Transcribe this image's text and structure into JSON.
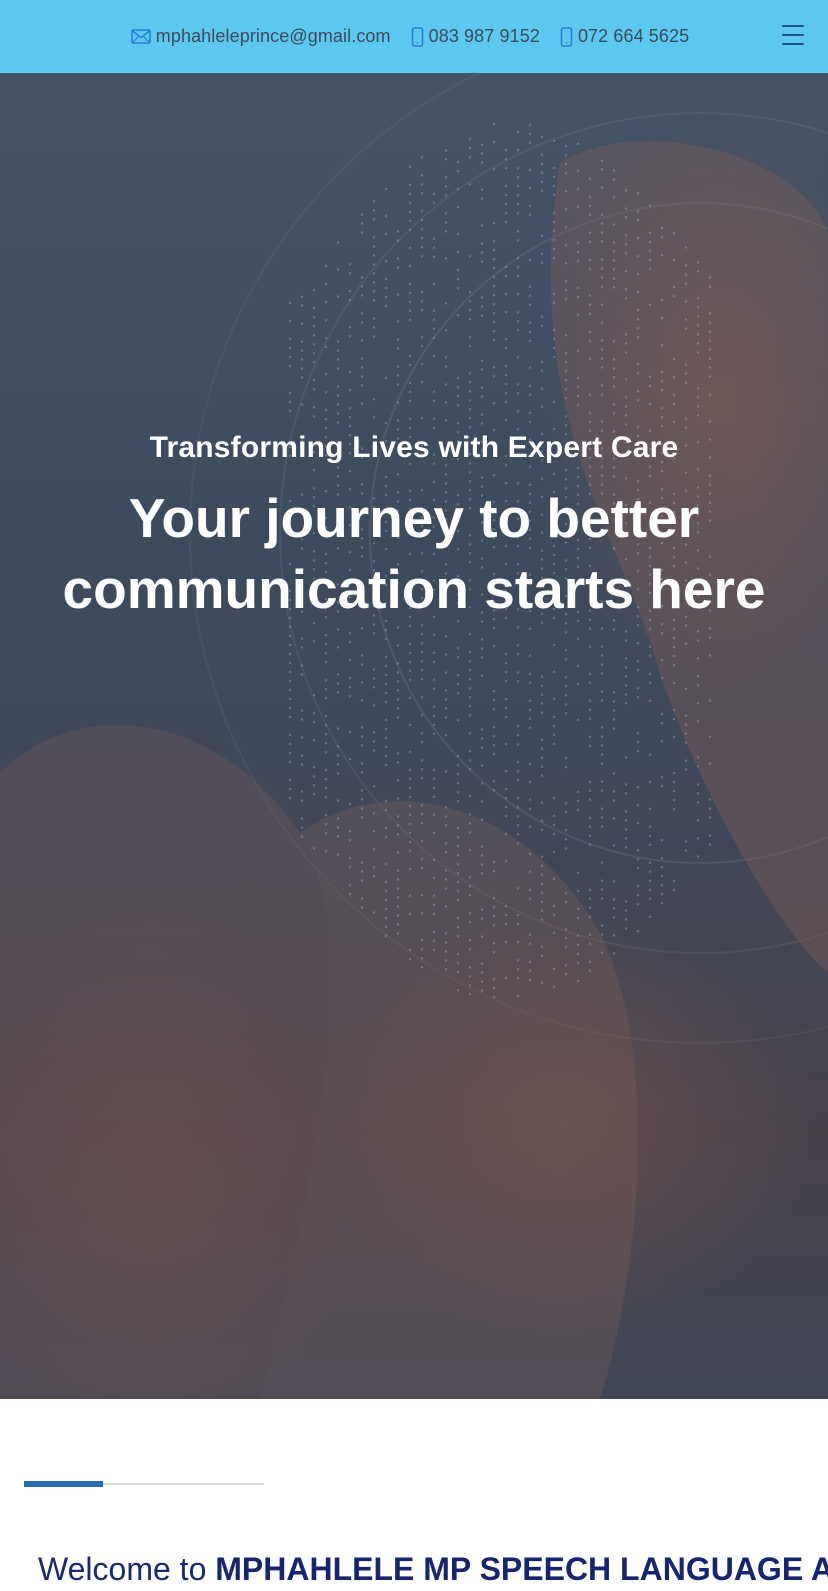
{
  "topbar": {
    "email": "mphahleleprince@gmail.com",
    "phone_1": "083 987 9152",
    "phone_2": "072 664 5625",
    "icons": {
      "email": "mail-icon",
      "phone": "mobile-phone-icon",
      "menu": "hamburger-menu-icon"
    },
    "bg_color": "#5bc8ef"
  },
  "hero": {
    "subtitle": "Transforming Lives with Expert Care",
    "title": "Your journey to better communication starts here"
  },
  "welcome": {
    "divider_progress": 0.33,
    "prefix": "Welcome to ",
    "brand": "MPHAHLELE MP SPEECH LANGUAGE AND"
  },
  "colors": {
    "accent": "#2b6bb6",
    "brand_text": "#16256d"
  }
}
